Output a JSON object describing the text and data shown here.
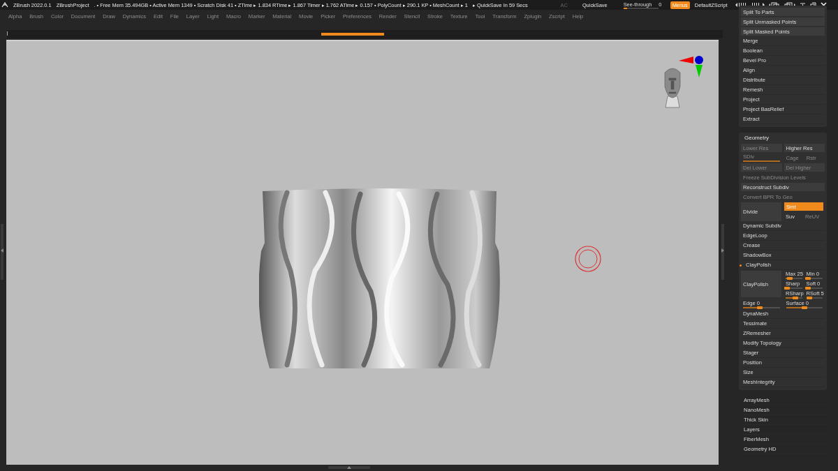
{
  "status_bar": {
    "app": "ZBrush 2022.0.1",
    "project": "ZBrushProject",
    "stats": ". • Free Mem 35.494GB • Active Mem 1349 • Scratch Disk 41 •  ZTime ▸ 1.834 RTime ▸ 1.867 Timer ▸ 1.762 ATime ▸ 0.157 • PolyCount ▸ 290.1 KP • MeshCount ▸ 1",
    "quicksave_timer": "▸ QuickSave In 59 Secs",
    "ac": "AC",
    "quicksave": "QuickSave",
    "see_through": {
      "label": "See-through",
      "value": "0",
      "level": 0.1
    },
    "menus": {
      "label": "Menus",
      "selected": true
    },
    "script": "DefaultZScript"
  },
  "menu": [
    "Alpha",
    "Brush",
    "Color",
    "Document",
    "Draw",
    "Dynamics",
    "Edit",
    "File",
    "Layer",
    "Light",
    "Macro",
    "Marker",
    "Material",
    "Movie",
    "Picker",
    "Preferences",
    "Render",
    "Stencil",
    "Stroke",
    "Texture",
    "Tool",
    "Transform",
    "Zplugin",
    "Zscript",
    "Help"
  ],
  "subtool_panel": [
    {
      "label": "Split To Parts",
      "kind": "boxed"
    },
    {
      "label": "Split Unmasked Points",
      "kind": "boxed"
    },
    {
      "label": "Split Masked Points",
      "kind": "boxed"
    },
    {
      "label": "Merge",
      "kind": "plain"
    },
    {
      "label": "Boolean",
      "kind": "plain"
    },
    {
      "label": "Bevel Pro",
      "kind": "plain"
    },
    {
      "label": "Align",
      "kind": "plain"
    },
    {
      "label": "Distribute",
      "kind": "plain"
    },
    {
      "label": "Remesh",
      "kind": "plain"
    },
    {
      "label": "Project",
      "kind": "plain"
    },
    {
      "label": "Project BasRelief",
      "kind": "plain"
    },
    {
      "label": "Extract",
      "kind": "plain"
    }
  ],
  "geometry": {
    "title": "Geometry",
    "rows": [
      {
        "kind": "pair",
        "items": [
          {
            "label": "Lower Res",
            "disabled": true
          },
          {
            "label": "Higher Res",
            "disabled": false
          }
        ]
      },
      {
        "kind": "sdiv",
        "slider": {
          "label": "SDiv",
          "disabled": true,
          "level": 1
        },
        "items": [
          {
            "label": "Cage",
            "disabled": true
          },
          {
            "label": "Rstr",
            "disabled": true
          }
        ]
      },
      {
        "kind": "pair",
        "items": [
          {
            "label": "Del Lower",
            "disabled": true
          },
          {
            "label": "Del Higher",
            "disabled": true
          }
        ]
      },
      {
        "kind": "full",
        "label": "Freeze SubDivision Levels",
        "disabled": true
      },
      {
        "kind": "full",
        "label": "Reconstruct Subdiv",
        "disabled": false
      },
      {
        "kind": "full",
        "label": "Convert BPR To Geo",
        "disabled": true
      },
      {
        "kind": "divide",
        "label": "Divide",
        "options": [
          {
            "label": "Smt",
            "selected": true,
            "disabled": false
          },
          {
            "label": "Suv",
            "selected": false,
            "disabled": false
          },
          {
            "label": "ReUV",
            "selected": false,
            "disabled": true
          }
        ]
      },
      {
        "kind": "item",
        "label": "Dynamic Subdiv"
      },
      {
        "kind": "item",
        "label": "EdgeLoop"
      },
      {
        "kind": "item",
        "label": "Crease"
      },
      {
        "kind": "item",
        "label": "ShadowBox"
      },
      {
        "kind": "toggle",
        "label": "ClayPolish",
        "on": true
      },
      {
        "kind": "block",
        "label": "ClayPolish",
        "sliders": [
          {
            "label": "Max 25",
            "level": 0.25
          },
          {
            "label": "Min 0",
            "level": 0.1
          },
          {
            "label": "Sharp",
            "level": 0.1
          },
          {
            "label": "Soft 0",
            "level": 0.1
          },
          {
            "label": "RSharp",
            "level": 0.6
          },
          {
            "label": "RSoft 5",
            "level": 0.2
          }
        ]
      },
      {
        "kind": "sliders",
        "sliders": [
          {
            "label": "Edge 0",
            "level": 0.45
          },
          {
            "label": "Surface 0",
            "level": 0.5
          }
        ]
      },
      {
        "kind": "item",
        "label": "DynaMesh"
      },
      {
        "kind": "item",
        "label": "Tessimate"
      },
      {
        "kind": "item",
        "label": "ZRemesher"
      },
      {
        "kind": "item",
        "label": "Modify Topology"
      },
      {
        "kind": "item",
        "label": "Stager"
      },
      {
        "kind": "item",
        "label": "Position"
      },
      {
        "kind": "item",
        "label": "Size"
      },
      {
        "kind": "item",
        "label": "MeshIntegrity"
      }
    ]
  },
  "more_sections": [
    "ArrayMesh",
    "NanoMesh",
    "Thick Skin",
    "Layers",
    "FiberMesh",
    "Geometry HD"
  ]
}
